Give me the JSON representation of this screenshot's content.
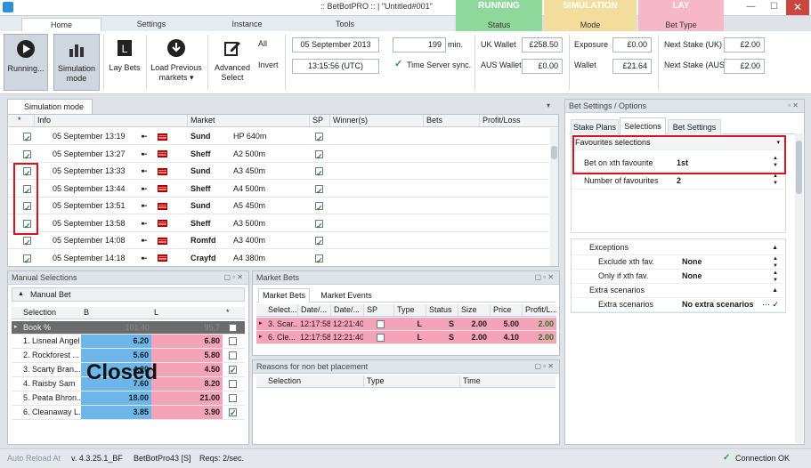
{
  "window": {
    "title": ":: BetBotPRO :: | \"Untitled#001\"",
    "minimize": "—",
    "maximize": "☐",
    "close": "✕"
  },
  "tabs": {
    "home": "Home",
    "settings": "Settings",
    "instance": "Instance",
    "tools": "Tools"
  },
  "modes": {
    "running": {
      "top": "RUNNING",
      "bottom": "Status"
    },
    "simulation": {
      "top": "SIMULATION",
      "bottom": "Mode"
    },
    "lay": {
      "top": "LAY",
      "bottom": "Bet Type"
    }
  },
  "ribbon": {
    "running": "Running...",
    "simulation_mode_1": "Simulation",
    "simulation_mode_2": "mode",
    "lay_bets": "Lay Bets",
    "load_previous_1": "Load Previous",
    "load_previous_2": "markets ▾",
    "advanced_select_1": "Advanced",
    "advanced_select_2": "Select",
    "all": "All",
    "invert": "Invert",
    "date": "05 September 2013",
    "time": "13:15:56 (UTC)",
    "minutes_value": "199",
    "minutes_unit": "min.",
    "time_server_sync": "Time Server sync.",
    "uk_wallet_label": "UK Wallet",
    "uk_wallet_value": "£258.50",
    "aus_wallet_label": "AUS Wallet",
    "aus_wallet_value": "£0.00",
    "exposure_label": "Exposure",
    "exposure_value": "£0.00",
    "wallet_label": "Wallet",
    "wallet_value": "£21.64",
    "next_stake_uk_label": "Next Stake (UK)",
    "next_stake_uk_value": "£2.00",
    "next_stake_aus_label": "Next Stake (AUS)",
    "next_stake_aus_value": "£2.00"
  },
  "simulation_tab": "Simulation mode",
  "markets_grid": {
    "headers": {
      "star": "*",
      "info": "Info",
      "market": "Market",
      "sp": "SP",
      "winners": "Winner(s)",
      "bets": "Bets",
      "profit": "Profit/Loss"
    },
    "rows": [
      {
        "date": "05 September 13:19",
        "venue": "Sund",
        "race": "HP 640m"
      },
      {
        "date": "05 September 13:27",
        "venue": "Sheff",
        "race": "A2 500m"
      },
      {
        "date": "05 September 13:33",
        "venue": "Sund",
        "race": "A3 450m"
      },
      {
        "date": "05 September 13:44",
        "venue": "Sheff",
        "race": "A4 500m"
      },
      {
        "date": "05 September 13:51",
        "venue": "Sund",
        "race": "A5 450m"
      },
      {
        "date": "05 September 13:58",
        "venue": "Sheff",
        "race": "A3 500m"
      },
      {
        "date": "05 September 14:08",
        "venue": "Romfd",
        "race": "A3 400m"
      },
      {
        "date": "05 September 14:18",
        "venue": "Crayfd",
        "race": "A4 380m"
      }
    ]
  },
  "manual_selections": {
    "title": "Manual Selections",
    "manual_bet": "Manual Bet",
    "headers": {
      "selection": "Selection",
      "b": "B",
      "l": "L",
      "star": "*"
    },
    "book": {
      "name": "Book %",
      "b": "101.40",
      "l": "95.7"
    },
    "closed_overlay": "Closed",
    "rows": [
      {
        "name": "1. Lisneal Angel",
        "b": "6.20",
        "l": "6.80",
        "checked": false
      },
      {
        "name": "2. Rockforest ...",
        "b": "5.60",
        "l": "5.80",
        "checked": false
      },
      {
        "name": "3. Scarty Bran...",
        "b": "4.20",
        "l": "4.50",
        "checked": true
      },
      {
        "name": "4. Raisby Sam",
        "b": "7.60",
        "l": "8.20",
        "checked": false
      },
      {
        "name": "5. Peata Bhron...",
        "b": "18.00",
        "l": "21.00",
        "checked": false
      },
      {
        "name": "6. Cleanaway L...",
        "b": "3.85",
        "l": "3.90",
        "checked": true
      }
    ]
  },
  "market_bets": {
    "title": "Market Bets",
    "tabs": {
      "bets": "Market Bets",
      "events": "Market Events"
    },
    "headers": {
      "selection": "Select...",
      "date1": "Date/...",
      "date2": "Date/...",
      "sp": "SP",
      "type": "Type",
      "status": "Status",
      "size": "Size",
      "price": "Price",
      "profit": "Profit/L..."
    },
    "rows": [
      {
        "selection": "3. Scar...",
        "date1": "12:17:58",
        "date2": "12:21:40",
        "type": "L",
        "status": "S",
        "size": "2.00",
        "price": "5.00",
        "profit": "2.00"
      },
      {
        "selection": "6. Cle...",
        "date1": "12:17:58",
        "date2": "12:21:40",
        "type": "L",
        "status": "S",
        "size": "2.00",
        "price": "4.10",
        "profit": "2.00"
      }
    ]
  },
  "reasons": {
    "title": "Reasons for non bet placement",
    "headers": {
      "selection": "Selection",
      "type": "Type",
      "time": "Time"
    }
  },
  "bet_settings": {
    "title": "Bet Settings / Options",
    "tabs": {
      "stake": "Stake Plans",
      "selections": "Selections",
      "settings": "Bet Settings"
    },
    "favourites_header": "Favourites selections",
    "bet_on_xth_label": "Bet on xth favourite",
    "bet_on_xth_value": "1st",
    "num_fav_label": "Number of favourites",
    "num_fav_value": "2",
    "exceptions_header": "Exceptions",
    "exclude_label": "Exclude xth fav.",
    "exclude_value": "None",
    "only_if_label": "Only if xth fav.",
    "only_if_value": "None",
    "extra_header": "Extra scenarios",
    "extra_label": "Extra scenarios",
    "extra_value": "No extra scenarios"
  },
  "status_bar": {
    "auto_reload": "Auto Reload At",
    "version": "v. 4.3.25.1_BF",
    "instance": "BetBotPro43 [S]",
    "reqs": "Reqs: 2/sec.",
    "connection": "Connection OK"
  }
}
